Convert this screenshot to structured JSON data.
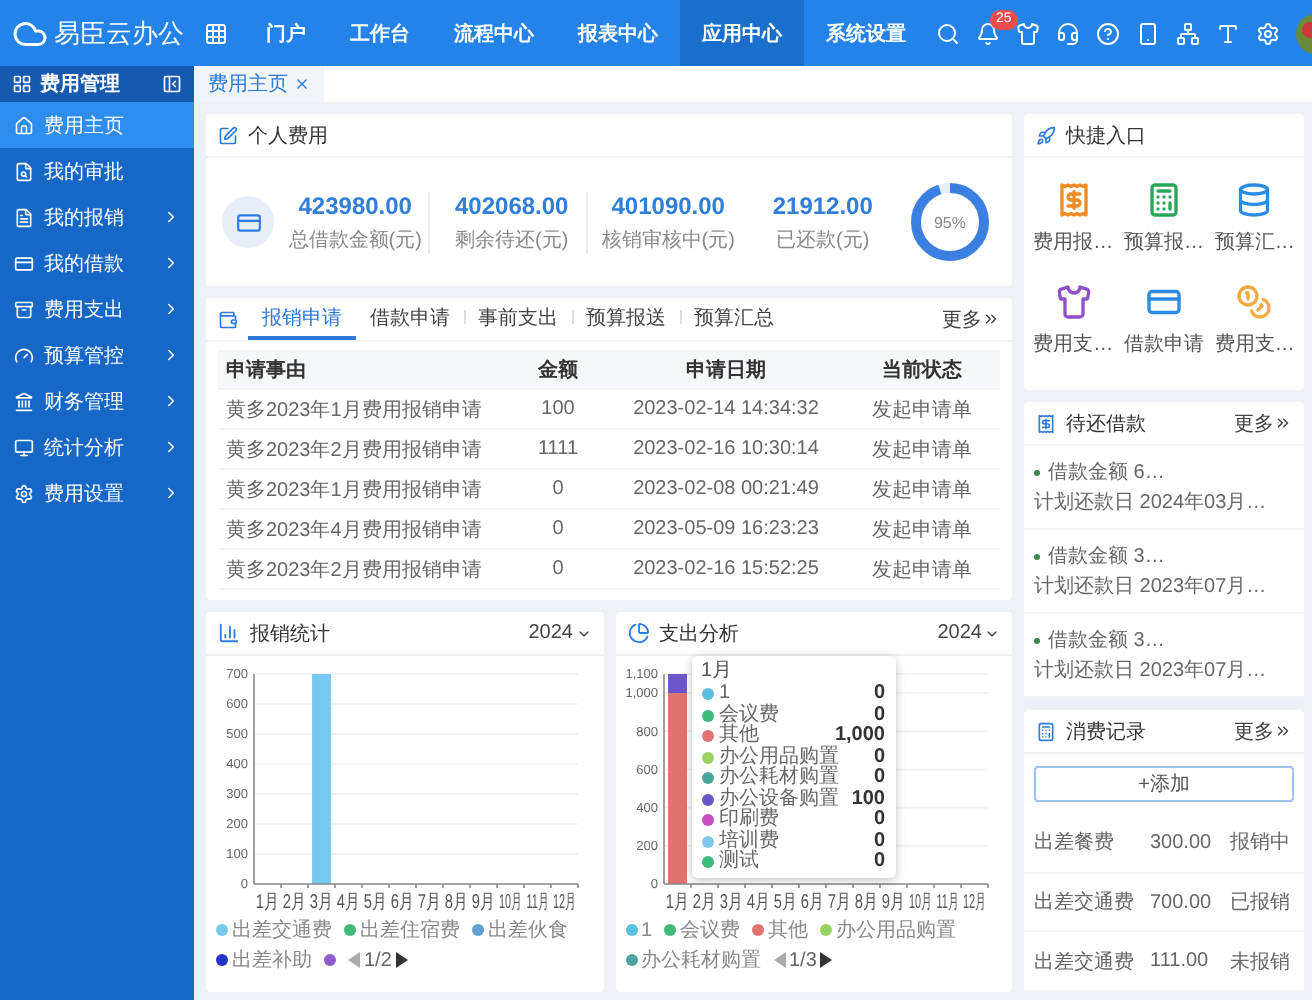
{
  "topbar": {
    "logo": "易臣云办公",
    "notification_count": "25",
    "nav": [
      {
        "label": "门户",
        "selected": false
      },
      {
        "label": "工作台",
        "selected": false
      },
      {
        "label": "流程中心",
        "selected": false
      },
      {
        "label": "报表中心",
        "selected": false
      },
      {
        "label": "应用中心",
        "selected": true
      },
      {
        "label": "系统设置",
        "selected": false
      }
    ]
  },
  "sidebar": {
    "title": "费用管理",
    "items": [
      {
        "label": "费用主页",
        "selected": true,
        "expandable": false
      },
      {
        "label": "我的审批",
        "selected": false,
        "expandable": false
      },
      {
        "label": "我的报销",
        "selected": false,
        "expandable": true
      },
      {
        "label": "我的借款",
        "selected": false,
        "expandable": true
      },
      {
        "label": "费用支出",
        "selected": false,
        "expandable": true
      },
      {
        "label": "预算管控",
        "selected": false,
        "expandable": true
      },
      {
        "label": "财务管理",
        "selected": false,
        "expandable": true
      },
      {
        "label": "统计分析",
        "selected": false,
        "expandable": true
      },
      {
        "label": "费用设置",
        "selected": false,
        "expandable": true
      }
    ]
  },
  "page_tabs": [
    {
      "label": "费用主页",
      "selected": true
    }
  ],
  "personal_cost": {
    "title": "个人费用",
    "stats": [
      {
        "value": "423980.00",
        "label": "总借款金额(元)"
      },
      {
        "value": "402068.00",
        "label": "剩余待还(元)"
      },
      {
        "value": "401090.00",
        "label": "核销审核中(元)"
      },
      {
        "value": "21912.00",
        "label": "已还款(元)"
      }
    ],
    "ratio": {
      "label": "95%",
      "level": 0.95
    }
  },
  "applications": {
    "more": "更多",
    "tabs": [
      {
        "label": "报销申请",
        "selected": true
      },
      {
        "label": "借款申请",
        "selected": false
      },
      {
        "label": "事前支出",
        "selected": false
      },
      {
        "label": "预算报送",
        "selected": false
      },
      {
        "label": "预算汇总",
        "selected": false
      }
    ],
    "columns": [
      "申请事由",
      "金额",
      "申请日期",
      "当前状态"
    ],
    "rows": [
      {
        "reason": "黄多2023年1月费用报销申请",
        "amount": "100",
        "date": "2023-02-14 14:34:32",
        "status": "发起申请单"
      },
      {
        "reason": "黄多2023年2月费用报销申请",
        "amount": "1111",
        "date": "2023-02-16 10:30:14",
        "status": "发起申请单"
      },
      {
        "reason": "黄多2023年1月费用报销申请",
        "amount": "0",
        "date": "2023-02-08 00:21:49",
        "status": "发起申请单"
      },
      {
        "reason": "黄多2023年4月费用报销申请",
        "amount": "0",
        "date": "2023-05-09 16:23:23",
        "status": "发起申请单"
      },
      {
        "reason": "黄多2023年2月费用报销申请",
        "amount": "0",
        "date": "2023-02-16 15:52:25",
        "status": "发起申请单"
      }
    ]
  },
  "reimburse_stats": {
    "title": "报销统计",
    "year": "2024",
    "pager": "1/2",
    "chart_data": {
      "type": "bar",
      "grid": true,
      "categories": [
        "1月",
        "2月",
        "3月",
        "4月",
        "5月",
        "6月",
        "7月",
        "8月",
        "9月",
        "10月",
        "11月",
        "12月"
      ],
      "series": [
        {
          "name": "出差交通费",
          "color": "#74c9f0",
          "values": [
            0,
            0,
            700,
            0,
            0,
            0,
            0,
            0,
            0,
            0,
            0,
            0
          ]
        },
        {
          "name": "出差住宿费",
          "color": "#3dbb7a",
          "values": [
            0,
            0,
            0,
            0,
            0,
            0,
            0,
            0,
            0,
            0,
            0,
            0
          ]
        },
        {
          "name": "出差伙食",
          "color": "#5fa0d0",
          "values": [
            0,
            0,
            0,
            0,
            0,
            0,
            0,
            0,
            0,
            0,
            0,
            0
          ]
        },
        {
          "name": "出差补助",
          "color": "#2233cc",
          "values": [
            0,
            0,
            0,
            0,
            0,
            0,
            0,
            0,
            0,
            0,
            0,
            0
          ]
        }
      ],
      "ylim": [
        0,
        700
      ],
      "yticks": [
        0,
        100,
        200,
        300,
        400,
        500,
        600,
        700
      ]
    },
    "legend_extra": [
      {
        "color": "#8e5cd0"
      }
    ]
  },
  "expense_analysis": {
    "title": "支出分析",
    "year": "2024",
    "pager": "1/3",
    "chart_data": {
      "type": "bar",
      "grid": true,
      "stacked": true,
      "categories": [
        "1月",
        "2月",
        "3月",
        "4月",
        "5月",
        "6月",
        "7月",
        "8月",
        "9月",
        "10月",
        "11月",
        "12月"
      ],
      "series": [
        {
          "name": "1",
          "color": "#5bc0de",
          "values": [
            0,
            0,
            0,
            0,
            0,
            0,
            0,
            0,
            0,
            0,
            0,
            0
          ]
        },
        {
          "name": "会议费",
          "color": "#3dbb7a",
          "values": [
            0,
            0,
            0,
            0,
            0,
            0,
            0,
            0,
            0,
            0,
            0,
            0
          ]
        },
        {
          "name": "其他",
          "color": "#e0736e",
          "values": [
            1000,
            0,
            0,
            0,
            0,
            0,
            0,
            0,
            0,
            0,
            0,
            0
          ]
        },
        {
          "name": "办公用品购置",
          "color": "#9ad163",
          "values": [
            0,
            0,
            0,
            0,
            0,
            0,
            0,
            0,
            0,
            0,
            0,
            0
          ]
        },
        {
          "name": "办公耗材购置",
          "color": "#4aa59a",
          "values": [
            0,
            0,
            0,
            0,
            0,
            0,
            0,
            0,
            0,
            0,
            0,
            0
          ]
        },
        {
          "name": "办公设备购置",
          "color": "#6b55c9",
          "values": [
            100,
            0,
            0,
            0,
            0,
            0,
            0,
            0,
            0,
            0,
            0,
            0
          ]
        },
        {
          "name": "印刷费",
          "color": "#c74fbf",
          "values": [
            0,
            0,
            0,
            0,
            0,
            0,
            0,
            0,
            0,
            0,
            0,
            0
          ]
        },
        {
          "name": "培训费",
          "color": "#7fc7e8",
          "values": [
            0,
            0,
            0,
            0,
            0,
            0,
            0,
            0,
            0,
            0,
            0,
            0
          ]
        },
        {
          "name": "测试",
          "color": "#3dbb7a",
          "values": [
            0,
            0,
            0,
            0,
            0,
            0,
            0,
            0,
            0,
            0,
            0,
            0
          ]
        }
      ],
      "ylim": [
        0,
        1100
      ],
      "yticks": [
        0,
        200,
        400,
        600,
        800,
        {
          "value": 1000,
          "label": "1,000"
        },
        {
          "value": 1100,
          "label": "1,100"
        }
      ]
    },
    "tooltip": {
      "title": "1月",
      "values": [
        "0",
        "0",
        "1,000",
        "0",
        "0",
        "100",
        "0",
        "0",
        "0"
      ]
    },
    "legend": [
      {
        "name": "1",
        "color": "#5bc0de"
      },
      {
        "name": "会议费",
        "color": "#3dbb7a"
      },
      {
        "name": "其他",
        "color": "#e0736e"
      },
      {
        "name": "办公用品购置",
        "color": "#9ad163"
      },
      {
        "name": "办公耗材购置",
        "color": "#4aa59a"
      }
    ]
  },
  "quick_entry": {
    "title": "快捷入口",
    "items": [
      {
        "label": "费用报…",
        "color": "#f08a24"
      },
      {
        "label": "预算报…",
        "color": "#27a65a"
      },
      {
        "label": "预算汇…",
        "color": "#2a8be0"
      },
      {
        "label": "费用支…",
        "color": "#8e4fc9"
      },
      {
        "label": "借款申请",
        "color": "#2a8be0"
      },
      {
        "label": "费用支…",
        "color": "#f2a93b"
      }
    ]
  },
  "loans_due": {
    "title": "待还借款",
    "more": "更多",
    "items": [
      {
        "amount": "借款金额 6…",
        "due": "计划还款日 2024年03月…"
      },
      {
        "amount": "借款金额 3…",
        "due": "计划还款日 2023年07月…"
      },
      {
        "amount": "借款金额 3…",
        "due": "计划还款日 2023年07月…"
      }
    ]
  },
  "consumption": {
    "title": "消费记录",
    "more": "更多",
    "add": "+添加",
    "rows": [
      {
        "item": "出差餐费",
        "amount": "300.00",
        "status": "报销中"
      },
      {
        "item": "出差交通费",
        "amount": "700.00",
        "status": "已报销"
      },
      {
        "item": "出差交通费",
        "amount": "111.00",
        "status": "未报销"
      }
    ]
  }
}
